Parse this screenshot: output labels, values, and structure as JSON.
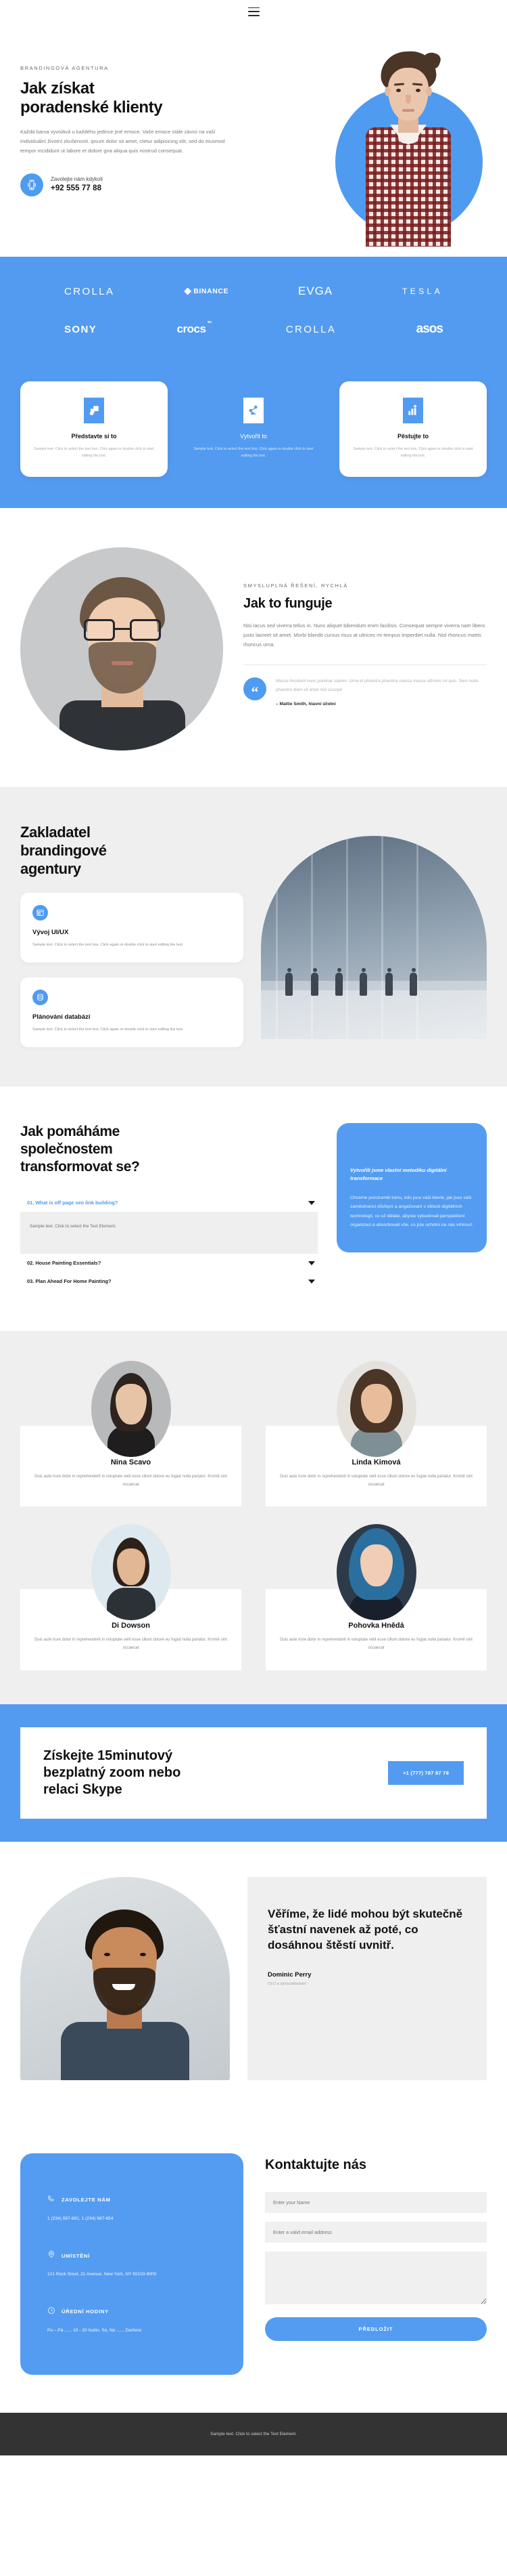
{
  "header": {
    "menu_icon": "hamburger-menu-icon"
  },
  "hero": {
    "eyebrow": "BRANDINGOVÁ AGENTURA",
    "title_line1": "Jak získat",
    "title_line2": "poradenské klienty",
    "paragraph": "Každá barva vyvolává u každého jedince jiné emoce. Vaše emoce stále závisí na vaší individuální životní zkušenosti. ipsum dolor sit amet, ctetur adipisicing elit, sed do eiusmod tempor incididunt ut labore et dolore gna aliqua quis nostrud consequat.",
    "call_label": "Zavolejte nám kdykoli",
    "call_number": "+92 555 77 88",
    "phone_icon": "mobile-phone-icon"
  },
  "logos": {
    "row1": [
      {
        "name": "CROLLA",
        "style": "crolla"
      },
      {
        "name": "BINANCE",
        "style": "binance"
      },
      {
        "name": "EVGA",
        "style": "evga"
      },
      {
        "name": "TESLA",
        "style": "tesla"
      }
    ],
    "row2": [
      {
        "name": "SONY",
        "style": "sony"
      },
      {
        "name": "crocs",
        "style": "crocs",
        "sup": "tm"
      },
      {
        "name": "CROLLA",
        "style": "crolla"
      },
      {
        "name": "asos",
        "style": "asos"
      }
    ]
  },
  "features": {
    "body": "Sample text. Click to select the text box. Click again or double click to start editing the text.",
    "cards": [
      {
        "title": "Představte si to",
        "icon": "shapes-icon",
        "variant": "solid"
      },
      {
        "title": "Vytvořit to",
        "icon": "node-network-icon",
        "variant": "ghost"
      },
      {
        "title": "Pěstujte to",
        "icon": "growth-chart-icon",
        "variant": "solid"
      }
    ]
  },
  "how": {
    "eyebrow": "SMYSLUPLNÁ ŘEŠENÍ, RYCHLÁ",
    "title": "Jak to funguje",
    "paragraph": "Nisi lacus sed viverra tellus in. Nunc aliquet bibendum enim facilisis. Consequat sempre viverra nam libero justo laoreet sit amet. Morbi blandit cursus risus at ultrices mi tempus imperdiet nulla. Nisl rhoncus mattis rhoncus urna.",
    "quote_icon": "quotation-mark-icon",
    "quote": "Massa tincidunt nunc pulvinar sapien. Urna et pharetra pharetra massa massa ultricies mi quis. Sem nulla pharetra diam sit amet nisl suscipit",
    "quote_author": "– Mattie Smith, hlavní účetní",
    "photo_alt": "man-with-glasses-portrait"
  },
  "founder": {
    "title_line1": "Zakladatel",
    "title_line2": "brandingové",
    "title_line3": "agentury",
    "cards": [
      {
        "title": "Vývoj UI/UX",
        "icon": "ui-layout-icon",
        "body": "Sample text. Click to select the text box. Click again or double click to start editing the text."
      },
      {
        "title": "Plánování databází",
        "icon": "database-icon",
        "body": "Sample text. Click to select the text box. Click again or double click to start editing the text."
      }
    ],
    "photo_alt": "people-walking-in-modern-hall"
  },
  "faq": {
    "title_line1": "Jak pomáháme",
    "title_line2": "společnostem",
    "title_line3": "transformovat se?",
    "items": [
      {
        "label": "01. What is off page seo link building?",
        "open": true,
        "body": "Sample text. Click to select the Text Element."
      },
      {
        "label": "02. House Painting Essentials?",
        "open": false,
        "body": ""
      },
      {
        "label": "03. Plan Ahead For Home Painting?",
        "open": false,
        "body": ""
      }
    ],
    "aside_title": "Vytvořili jsme vlastní metodiku digitální transformace",
    "aside_body": "Chceme porozumět tomu, kdo jsou vaši klienti, jak jsou vaši zaměstnanci důvtipní a angažovaní v oblasti digitálních technologií, co už děláte, abyste vybudovali perspektivní organizaci a absorbovali vše, co jste ochotni na nás vrhnout."
  },
  "team": {
    "bio": "Duis aute irure dolor in reprehenderit in voluptate velit esse cillum dolore eu fugiat nulla pariatur. Kromě sint occaecat",
    "members": [
      {
        "name": "Nina Scavo",
        "avatar": "woman-dark-hair-portrait",
        "bg": "#b8b9ba",
        "hair": "#2e241f",
        "skin": "#e8c4a6",
        "body": "#1f1d1d"
      },
      {
        "name": "Linda Kimová",
        "avatar": "woman-curly-hair-portrait",
        "bg": "#e5e2dd",
        "hair": "#4a3526",
        "skin": "#e7bd9c",
        "body": "#7e8f96"
      },
      {
        "name": "Di Dowson",
        "avatar": "man-in-kitchen-portrait",
        "bg": "#dde8ef",
        "hair": "#2c2119",
        "skin": "#e2b794",
        "body": "#2c3136"
      },
      {
        "name": "Pohovka Hnědá",
        "avatar": "woman-blue-hair-portrait",
        "bg": "#2d3a4a",
        "hair": "#2b6f9e",
        "skin": "#f0cdb4",
        "body": "#17202b"
      }
    ]
  },
  "cta": {
    "title_line1": "Získejte 15minutový",
    "title_line2": "bezplatný zoom nebo",
    "title_line3": "relaci Skype",
    "button": "+1 (777) 787 87 78"
  },
  "belief": {
    "quote": "Věříme, že lidé mohou být skutečně šťastní navenek až poté, co dosáhnou štěstí uvnitř.",
    "name": "Dominic Perry",
    "role": "CEO a spoluzakladatel",
    "photo_alt": "smiling-man-portrait"
  },
  "contact": {
    "items": [
      {
        "icon": "phone-icon",
        "label": "ZAVOLEJTE NÁM",
        "value": "1 (234) 567-891, 1 (234) 987-654"
      },
      {
        "icon": "map-pin-icon",
        "label": "UMÍSTĚNÍ",
        "value": "121 Rock Sreet, 21 Avenue, New York, NY 92103-9000"
      },
      {
        "icon": "clock-icon",
        "label": "ÚŘEDNÍ HODINY",
        "value": "Po – Pá ...... 10 - 20 hodin, So, Ne ...... Zavřeno"
      }
    ],
    "form_title": "Kontaktujte nás",
    "name_placeholder": "Enter your Name",
    "email_placeholder": "Enter a valid email address",
    "message_placeholder": "",
    "submit_label": "PŘEDLOŽIT"
  },
  "footer": {
    "text": "Sample text. Click to select the Text Element."
  },
  "colors": {
    "accent": "#539bf0",
    "accent_dark": "#4f9bf0",
    "light_gray": "#efefef",
    "footer": "#333333"
  }
}
